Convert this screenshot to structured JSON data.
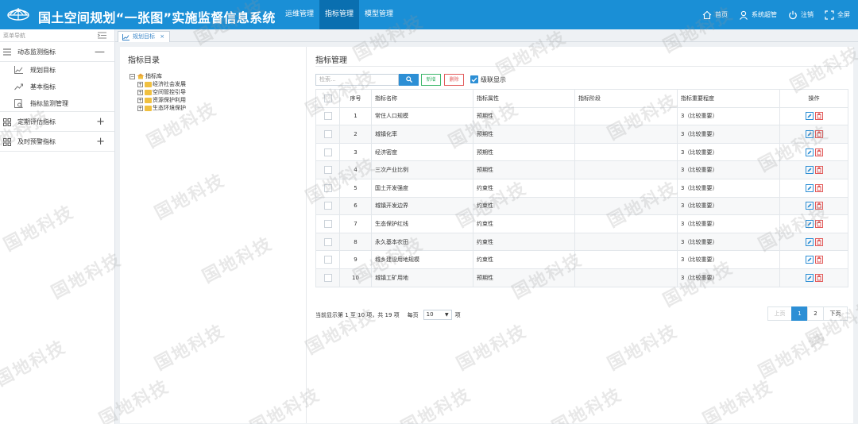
{
  "app": {
    "title": "国土空间规划“一张图”实施监督信息系统",
    "nav": [
      {
        "label": "运维管理",
        "active": false
      },
      {
        "label": "指标管理",
        "active": true
      },
      {
        "label": "模型管理",
        "active": false
      }
    ],
    "top_right": {
      "home": "首页",
      "user": "系统超管",
      "logout": "注销",
      "fullscreen": "全屏"
    }
  },
  "sidebar": {
    "header": "菜单导航",
    "groups": [
      {
        "label": "动态监测指标",
        "sign": "—",
        "items": [
          "规划目标",
          "基本指标",
          "指标监测管理"
        ]
      },
      {
        "label": "定期评估指标",
        "sign": "+"
      },
      {
        "label": "及时预警指标",
        "sign": "+"
      }
    ]
  },
  "tab": {
    "label": "规划目标",
    "close": "×"
  },
  "catalog": {
    "title": "指标目录",
    "root": "指标库",
    "children": [
      "经济社会发展",
      "空间管控引导",
      "资源保护利用",
      "生态环境保护"
    ]
  },
  "management": {
    "title": "指标管理",
    "search_placeholder": "检索...",
    "add_label": "新增",
    "delete_label": "删除",
    "cascade_label": "级联显示",
    "columns": [
      "序号",
      "指标名称",
      "指标属性",
      "指标阶段",
      "指标重要程度",
      "操作"
    ],
    "rows": [
      {
        "no": "1",
        "name": "常住人口规模",
        "attr": "预期性",
        "stage": "",
        "importance": "3（比较重要）"
      },
      {
        "no": "2",
        "name": "城镇化率",
        "attr": "预期性",
        "stage": "",
        "importance": "3（比较重要）"
      },
      {
        "no": "3",
        "name": "经济密度",
        "attr": "预期性",
        "stage": "",
        "importance": "3（比较重要）"
      },
      {
        "no": "4",
        "name": "三次产业比例",
        "attr": "预期性",
        "stage": "",
        "importance": "3（比较重要）"
      },
      {
        "no": "5",
        "name": "国土开发强度",
        "attr": "约束性",
        "stage": "",
        "importance": "3（比较重要）"
      },
      {
        "no": "6",
        "name": "城镇开发边界",
        "attr": "约束性",
        "stage": "",
        "importance": "3（比较重要）"
      },
      {
        "no": "7",
        "name": "生态保护红线",
        "attr": "约束性",
        "stage": "",
        "importance": "3（比较重要）"
      },
      {
        "no": "8",
        "name": "永久基本农田",
        "attr": "约束性",
        "stage": "",
        "importance": "3（比较重要）"
      },
      {
        "no": "9",
        "name": "城乡建设用地规模",
        "attr": "约束性",
        "stage": "",
        "importance": "3（比较重要）"
      },
      {
        "no": "10",
        "name": "城镇工矿用地",
        "attr": "预期性",
        "stage": "",
        "importance": "3（比较重要）"
      }
    ],
    "pager": {
      "info": "当前显示第 1 至 10 项，共 19 项",
      "per_page_label": "每页",
      "per_page_value": "10",
      "per_page_suffix": "项",
      "prev": "上页",
      "pages": [
        "1",
        "2"
      ],
      "current": "1",
      "next": "下页"
    }
  },
  "watermark": "国地科技",
  "colors": {
    "header": "#1a8fd6",
    "nav_active": "#0a6fb0",
    "primary": "#2d8fd5",
    "add": "#3bb66a",
    "delete": "#e25b5b"
  }
}
